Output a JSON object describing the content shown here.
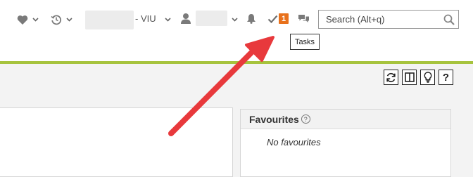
{
  "header": {
    "org_suffix": "- VIU",
    "tasks_badge_count": "1",
    "tasks_tooltip": "Tasks",
    "icons": [
      "heart-icon",
      "history-icon",
      "user-icon",
      "bell-icon",
      "check-icon",
      "chat-icon",
      "search-icon"
    ]
  },
  "search": {
    "placeholder": "Search (Alt+q)"
  },
  "favourites": {
    "title": "Favourites",
    "help": "?",
    "empty_text": "No favourites"
  },
  "toolbar": {
    "icons": [
      "refresh-icon",
      "layout-icon",
      "lightbulb-icon",
      "help-icon"
    ],
    "help_label": "?"
  },
  "colors": {
    "accent_line": "#a6c33d",
    "badge": "#e8711c",
    "annotation_arrow": "#e8393c"
  }
}
